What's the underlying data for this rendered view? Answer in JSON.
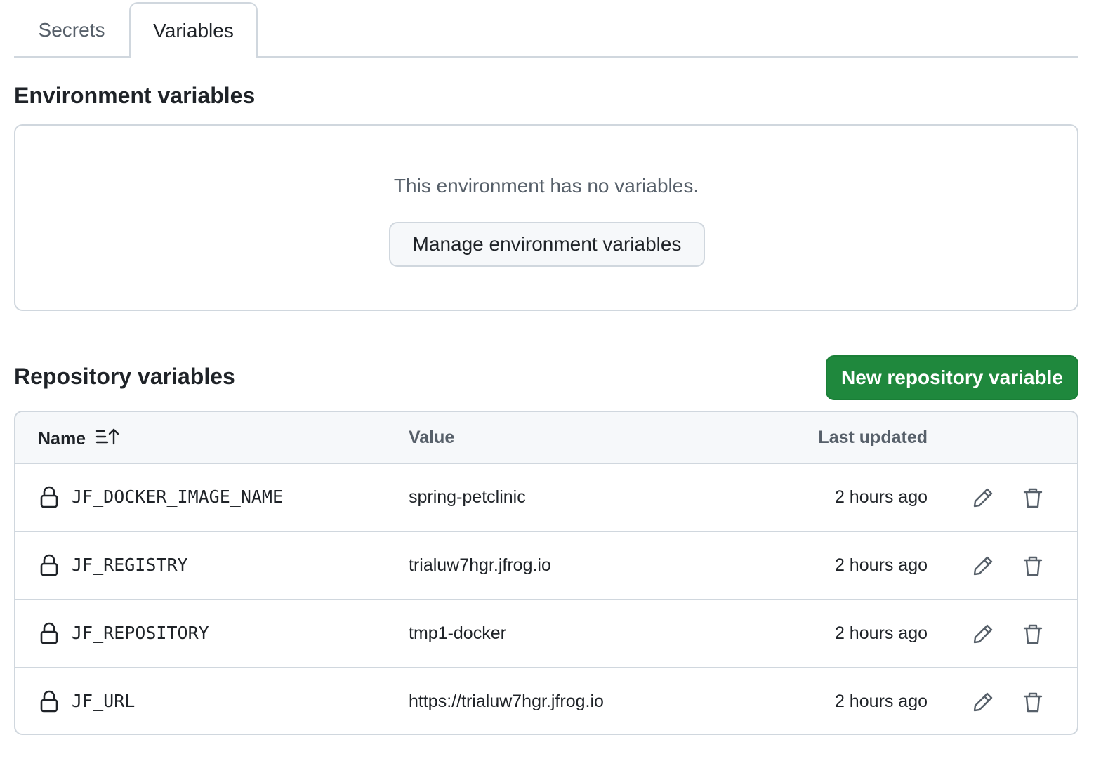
{
  "tabs": [
    {
      "label": "Secrets",
      "active": false
    },
    {
      "label": "Variables",
      "active": true
    }
  ],
  "environment": {
    "heading": "Environment variables",
    "empty_message": "This environment has no variables.",
    "manage_button": "Manage environment variables"
  },
  "repository": {
    "heading": "Repository variables",
    "new_button": "New repository variable",
    "columns": {
      "name": "Name",
      "value": "Value",
      "last_updated": "Last updated"
    },
    "rows": [
      {
        "name": "JF_DOCKER_IMAGE_NAME",
        "value": "spring-petclinic",
        "updated": "2 hours ago"
      },
      {
        "name": "JF_REGISTRY",
        "value": "trialuw7hgr.jfrog.io",
        "updated": "2 hours ago"
      },
      {
        "name": "JF_REPOSITORY",
        "value": "tmp1-docker",
        "updated": "2 hours ago"
      },
      {
        "name": "JF_URL",
        "value": "https://trialuw7hgr.jfrog.io",
        "updated": "2 hours ago"
      }
    ]
  },
  "colors": {
    "primary_button": "#1f883d",
    "border": "#d0d7de",
    "muted_text": "#57606a"
  },
  "icons": [
    "sort-ascending-icon",
    "lock-icon",
    "pencil-icon",
    "trash-icon"
  ]
}
